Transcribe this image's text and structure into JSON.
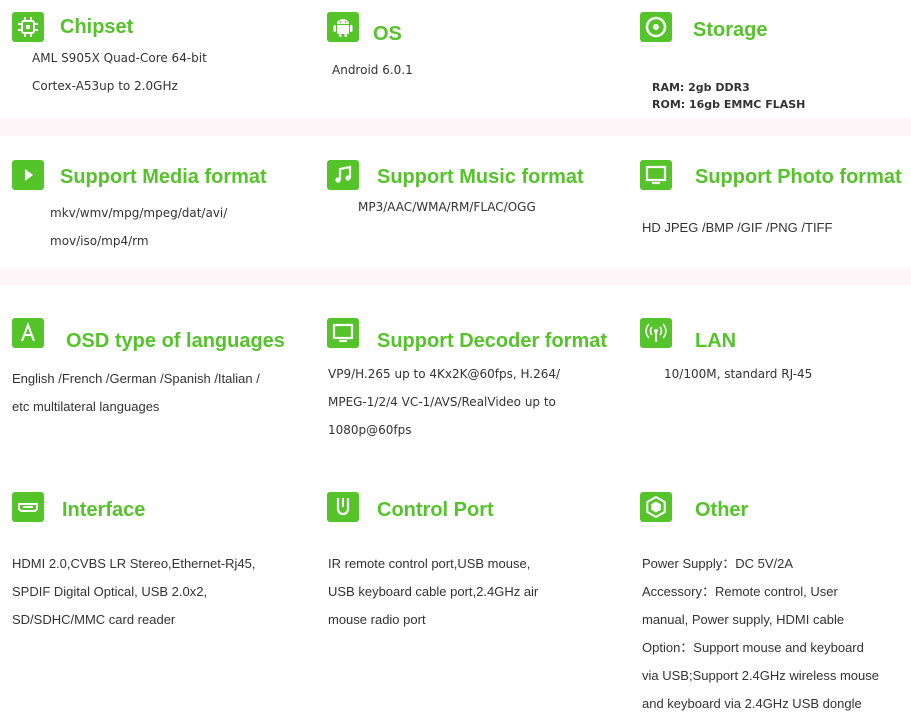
{
  "colors": {
    "accent": "#55c32a",
    "text": "#333333"
  },
  "features": [
    {
      "id": "chipset",
      "icon": "chip-icon",
      "title": "Chipset",
      "lines": [
        "AML S905X Quad-Core 64-bit",
        "Cortex-A53up to 2.0GHz"
      ]
    },
    {
      "id": "os",
      "icon": "android-icon",
      "title": "OS",
      "lines": [
        "Android 6.0.1"
      ]
    },
    {
      "id": "storage",
      "icon": "disc-icon",
      "title": "Storage",
      "lines": [
        "RAM: 2gb DDR3",
        "ROM: 16gb EMMC FLASH"
      ]
    },
    {
      "id": "media",
      "icon": "play-icon",
      "title": "Support Media format",
      "lines": [
        "mkv/wmv/mpg/mpeg/dat/avi/",
        "mov/iso/mp4/rm"
      ]
    },
    {
      "id": "music",
      "icon": "music-note-icon",
      "title": "Support Music format",
      "lines": [
        "MP3/AAC/WMA/RM/FLAC/OGG"
      ]
    },
    {
      "id": "photo",
      "icon": "monitor-icon",
      "title": "Support Photo format",
      "lines": [
        "HD JPEG /BMP /GIF /PNG /TIFF"
      ]
    },
    {
      "id": "osd",
      "icon": "letter-a-icon",
      "title": "OSD type of languages",
      "lines": [
        "English /French /German /Spanish /Italian /",
        "etc multilateral languages"
      ]
    },
    {
      "id": "decoder",
      "icon": "monitor-icon",
      "title": "Support Decoder format",
      "lines": [
        "VP9/H.265 up to 4Kx2K@60fps, H.264/",
        "MPEG-1/2/4 VC-1/AVS/RealVideo up to",
        "1080p@60fps"
      ]
    },
    {
      "id": "lan",
      "icon": "antenna-icon",
      "title": "LAN",
      "lines": [
        "10/100M, standard RJ-45"
      ]
    },
    {
      "id": "interface",
      "icon": "hdmi-port-icon",
      "title": "Interface",
      "lines": [
        "HDMI 2.0,CVBS LR Stereo,Ethernet-Rj45,",
        "SPDIF Digital Optical, USB 2.0x2,",
        "SD/SDHC/MMC  card reader"
      ]
    },
    {
      "id": "control",
      "icon": "usb-port-icon",
      "title": "Control Port",
      "lines": [
        "IR remote control port,USB mouse,",
        "USB keyboard cable port,2.4GHz air",
        "mouse radio port"
      ]
    },
    {
      "id": "other",
      "icon": "hexagon-icon",
      "title": "Other",
      "lines": [
        "Power Supply：DC 5V/2A",
        "Accessory：Remote control, User",
        "manual, Power supply, HDMI cable",
        "Option：Support mouse and keyboard",
        "via USB;Support 2.4GHz wireless mouse",
        "and keyboard via 2.4GHz USB dongle"
      ]
    }
  ]
}
